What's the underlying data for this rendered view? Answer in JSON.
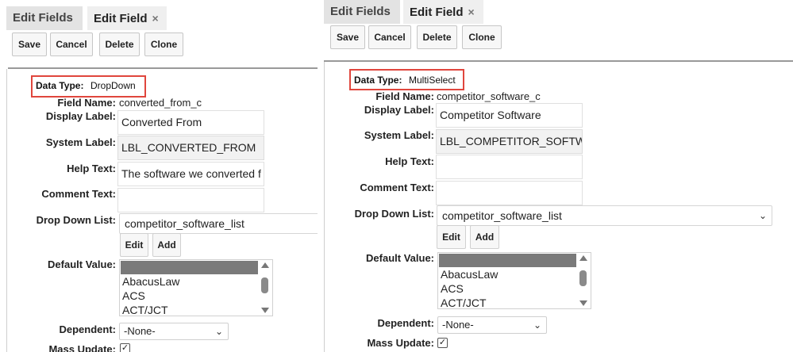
{
  "panels": [
    {
      "tabs": [
        {
          "label": "Edit Fields"
        },
        {
          "label": "Edit Field",
          "close": "×"
        }
      ],
      "buttons": {
        "save": "Save",
        "cancel": "Cancel",
        "delete": "Delete",
        "clone": "Clone"
      },
      "data_type": {
        "label": "Data Type:",
        "value": "DropDown"
      },
      "field_name": {
        "label": "Field Name:",
        "value": "converted_from_c"
      },
      "display_label": {
        "label": "Display Label:",
        "value": "Converted From"
      },
      "system_label": {
        "label": "System Label:",
        "value": "LBL_CONVERTED_FROM"
      },
      "help_text": {
        "label": "Help Text:",
        "value": "The software we converted f"
      },
      "comment_text": {
        "label": "Comment Text:",
        "value": ""
      },
      "drop_down_list": {
        "label": "Drop Down List:",
        "value": "competitor_software_list"
      },
      "list_buttons": {
        "edit": "Edit",
        "add": "Add"
      },
      "default_value": {
        "label": "Default Value:",
        "options": [
          "AbacusLaw",
          "ACS",
          "ACT/JCT"
        ]
      },
      "dependent": {
        "label": "Dependent:",
        "value": "-None-"
      },
      "mass_update": {
        "label": "Mass Update:",
        "checked": "✓"
      }
    },
    {
      "tabs": [
        {
          "label": "Edit Fields"
        },
        {
          "label": "Edit Field",
          "close": "×"
        }
      ],
      "buttons": {
        "save": "Save",
        "cancel": "Cancel",
        "delete": "Delete",
        "clone": "Clone"
      },
      "data_type": {
        "label": "Data Type:",
        "value": "MultiSelect"
      },
      "field_name": {
        "label": "Field Name:",
        "value": "competitor_software_c"
      },
      "display_label": {
        "label": "Display Label:",
        "value": "Competitor Software"
      },
      "system_label": {
        "label": "System Label:",
        "value": "LBL_COMPETITOR_SOFTW"
      },
      "help_text": {
        "label": "Help Text:",
        "value": ""
      },
      "comment_text": {
        "label": "Comment Text:",
        "value": ""
      },
      "drop_down_list": {
        "label": "Drop Down List:",
        "value": "competitor_software_list"
      },
      "list_buttons": {
        "edit": "Edit",
        "add": "Add"
      },
      "default_value": {
        "label": "Default Value:",
        "options": [
          "AbacusLaw",
          "ACS",
          "ACT/JCT"
        ]
      },
      "dependent": {
        "label": "Dependent:",
        "value": "-None-"
      },
      "mass_update": {
        "label": "Mass Update:",
        "checked": "✓"
      }
    }
  ],
  "colors": {
    "highlight": "#e0463d",
    "tab_bg": "#e3e3e3",
    "selected_option": "#7a7a7a"
  }
}
